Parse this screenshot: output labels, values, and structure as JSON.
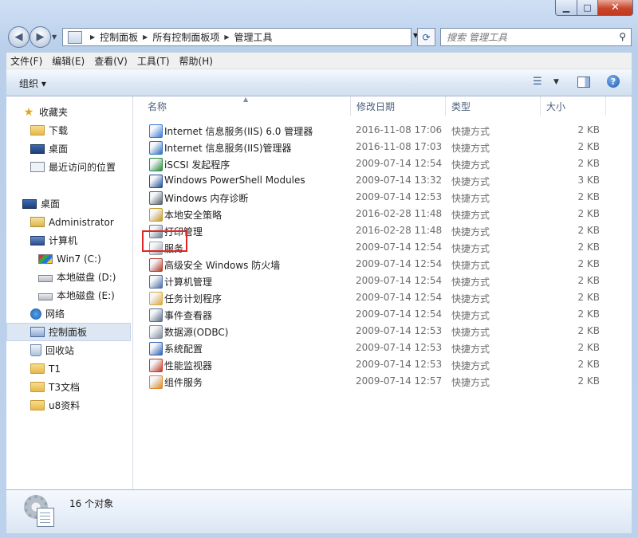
{
  "window": {
    "minimize": "▁",
    "maximize": "□",
    "close": "✕"
  },
  "nav": {
    "breadcrumbs": [
      "控制面板",
      "所有控制面板项",
      "管理工具"
    ],
    "search_placeholder": "搜索 管理工具"
  },
  "menu": [
    "文件(F)",
    "编辑(E)",
    "查看(V)",
    "工具(T)",
    "帮助(H)"
  ],
  "toolbar": {
    "organize": "组织 ▾"
  },
  "sidebar": {
    "favorites": {
      "header": "收藏夹",
      "items": [
        "下载",
        "桌面",
        "最近访问的位置"
      ]
    },
    "desktop": {
      "header": "桌面",
      "items": [
        {
          "label": "Administrator",
          "indent": 1,
          "icon": "user-folder-icon"
        },
        {
          "label": "计算机",
          "indent": 1,
          "icon": "computer-icon"
        },
        {
          "label": "Win7 (C:)",
          "indent": 2,
          "icon": "windows-drive-icon"
        },
        {
          "label": "本地磁盘 (D:)",
          "indent": 2,
          "icon": "drive-icon"
        },
        {
          "label": "本地磁盘 (E:)",
          "indent": 2,
          "icon": "drive-icon"
        },
        {
          "label": "网络",
          "indent": 1,
          "icon": "network-icon"
        },
        {
          "label": "控制面板",
          "indent": 1,
          "icon": "control-panel-icon",
          "selected": true
        },
        {
          "label": "回收站",
          "indent": 1,
          "icon": "recycle-bin-icon"
        },
        {
          "label": "T1",
          "indent": 1,
          "icon": "folder-icon"
        },
        {
          "label": "T3文档",
          "indent": 1,
          "icon": "folder-icon"
        },
        {
          "label": "u8资料",
          "indent": 1,
          "icon": "folder-icon"
        }
      ]
    }
  },
  "columns": {
    "name": "名称",
    "date": "修改日期",
    "type": "类型",
    "size": "大小"
  },
  "files": [
    {
      "name": "Internet 信息服务(IIS) 6.0 管理器",
      "date": "2016-11-08 17:06",
      "type": "快捷方式",
      "size": "2 KB",
      "color": "#3a7bd5"
    },
    {
      "name": "Internet 信息服务(IIS)管理器",
      "date": "2016-11-08 17:03",
      "type": "快捷方式",
      "size": "2 KB",
      "color": "#2f6fc0"
    },
    {
      "name": "iSCSI 发起程序",
      "date": "2009-07-14 12:54",
      "type": "快捷方式",
      "size": "2 KB",
      "color": "#2a8a3e"
    },
    {
      "name": "Windows PowerShell Modules",
      "date": "2009-07-14 13:32",
      "type": "快捷方式",
      "size": "3 KB",
      "color": "#1f4f99"
    },
    {
      "name": "Windows 内存诊断",
      "date": "2009-07-14 12:53",
      "type": "快捷方式",
      "size": "2 KB",
      "color": "#555f6b"
    },
    {
      "name": "本地安全策略",
      "date": "2016-02-28 11:48",
      "type": "快捷方式",
      "size": "2 KB",
      "color": "#c49a2a"
    },
    {
      "name": "打印管理",
      "date": "2016-02-28 11:48",
      "type": "快捷方式",
      "size": "2 KB",
      "color": "#6f7f93"
    },
    {
      "name": "服务",
      "date": "2009-07-14 12:54",
      "type": "快捷方式",
      "size": "2 KB",
      "color": "#9aa3ad"
    },
    {
      "name": "高级安全 Windows 防火墙",
      "date": "2009-07-14 12:54",
      "type": "快捷方式",
      "size": "2 KB",
      "color": "#b33b2b"
    },
    {
      "name": "计算机管理",
      "date": "2009-07-14 12:54",
      "type": "快捷方式",
      "size": "2 KB",
      "color": "#4a6fa5"
    },
    {
      "name": "任务计划程序",
      "date": "2009-07-14 12:54",
      "type": "快捷方式",
      "size": "2 KB",
      "color": "#d9a93a"
    },
    {
      "name": "事件查看器",
      "date": "2009-07-14 12:54",
      "type": "快捷方式",
      "size": "2 KB",
      "color": "#5b6f8a"
    },
    {
      "name": "数据源(ODBC)",
      "date": "2009-07-14 12:53",
      "type": "快捷方式",
      "size": "2 KB",
      "color": "#7e8a99"
    },
    {
      "name": "系统配置",
      "date": "2009-07-14 12:53",
      "type": "快捷方式",
      "size": "2 KB",
      "color": "#2f63b4"
    },
    {
      "name": "性能监视器",
      "date": "2009-07-14 12:53",
      "type": "快捷方式",
      "size": "2 KB",
      "color": "#c23a2a"
    },
    {
      "name": "组件服务",
      "date": "2009-07-14 12:57",
      "type": "快捷方式",
      "size": "2 KB",
      "color": "#d98a2a"
    }
  ],
  "status": {
    "count": "16 个对象"
  },
  "colors": {
    "highlight": "#e02525",
    "selected_bg": "#dde7f3"
  }
}
